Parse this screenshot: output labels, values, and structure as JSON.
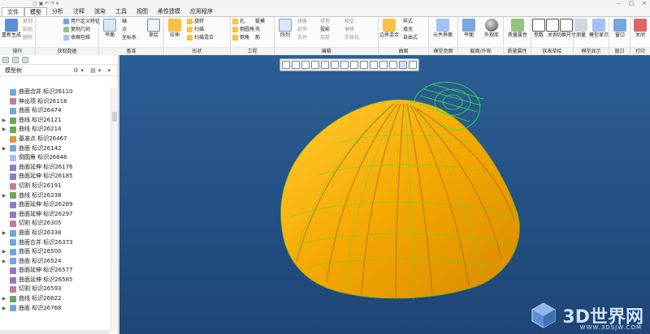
{
  "tabs": [
    "文件",
    "模型",
    "分析",
    "注释",
    "渲染",
    "工具",
    "视图",
    "柔性建模",
    "应用程序"
  ],
  "active_tab": "模型",
  "ribbon": {
    "groups": [
      {
        "label": "操作",
        "big": [
          "重新生成"
        ],
        "small": [
          "复制",
          "粘贴",
          "删除"
        ]
      },
      {
        "label": "获取数据",
        "small": [
          "用户定义特征",
          "复制几何",
          "收缩包络"
        ]
      },
      {
        "label": "基准",
        "big": [
          "平面"
        ],
        "small": [
          "轴",
          "点",
          "坐标系"
        ],
        "extra": [
          "草绘"
        ]
      },
      {
        "label": "形状",
        "big": [
          "拉伸"
        ],
        "small": [
          "旋转",
          "扫描",
          "扫描混合"
        ]
      },
      {
        "label": "工程",
        "small": [
          "孔",
          "倒圆角",
          "倒角",
          "拔模",
          "壳",
          "筋"
        ]
      },
      {
        "label": "编辑",
        "big": [
          "阵列"
        ],
        "small": [
          "镜像",
          "延伸",
          "合并",
          "修剪",
          "投影",
          "加厚",
          "相交",
          "偏移",
          "实体化"
        ]
      },
      {
        "label": "曲面",
        "big": [
          "边界混合"
        ],
        "small": [
          "样式",
          "填充",
          "自由式"
        ]
      },
      {
        "label": "模型意图",
        "big": [
          "元件界面"
        ]
      },
      {
        "label": "截面/外观",
        "big": [
          "平面",
          "外观库"
        ]
      },
      {
        "label": "质量属性",
        "big": [
          "质量属性"
        ]
      },
      {
        "label": "族表草绘",
        "big": [
          "参数",
          "关系",
          "切换尺寸"
        ]
      },
      {
        "label": "模型显示",
        "big": [
          "测量",
          "模型显示"
        ]
      },
      {
        "label": "窗口",
        "big": [
          "窗口"
        ]
      },
      {
        "label": "打印",
        "big": [
          "关闭"
        ]
      }
    ]
  },
  "model_tree": {
    "title": "模型树",
    "items": [
      {
        "label": "曲面合并 标识26110",
        "expand": "",
        "color": "#6fa8dc"
      },
      {
        "label": "伸出项 标识26118",
        "expand": "",
        "color": "#c27ba0"
      },
      {
        "label": "曲面 标识26474",
        "expand": "",
        "color": "#6fa8dc"
      },
      {
        "label": "曲线 标识26121",
        "expand": "▶",
        "color": "#6aa84f"
      },
      {
        "label": "曲线 标识26214",
        "expand": "▶",
        "color": "#6aa84f"
      },
      {
        "label": "基准点 标识26467",
        "expand": "",
        "color": "#e69138"
      },
      {
        "label": "曲面 标识26142",
        "expand": "▶",
        "color": "#6fa8dc"
      },
      {
        "label": "倒圆角 标识26646",
        "expand": "",
        "color": "#a4c2f4"
      },
      {
        "label": "曲面延伸 标识26176",
        "expand": "",
        "color": "#8e7cc3"
      },
      {
        "label": "曲面延伸 标识26185",
        "expand": "",
        "color": "#8e7cc3"
      },
      {
        "label": "切割 标识26191",
        "expand": "",
        "color": "#c27ba0"
      },
      {
        "label": "曲线 标识26238",
        "expand": "▶",
        "color": "#6aa84f"
      },
      {
        "label": "曲面延伸 标识26289",
        "expand": "",
        "color": "#8e7cc3"
      },
      {
        "label": "曲面延伸 标识26297",
        "expand": "",
        "color": "#8e7cc3"
      },
      {
        "label": "切割 标识26305",
        "expand": "",
        "color": "#c27ba0"
      },
      {
        "label": "曲面 标识26338",
        "expand": "▶",
        "color": "#6fa8dc"
      },
      {
        "label": "曲面合并 标识26373",
        "expand": "",
        "color": "#6fa8dc"
      },
      {
        "label": "曲面 标识26500",
        "expand": "▶",
        "color": "#6fa8dc"
      },
      {
        "label": "曲面 标识26524",
        "expand": "▶",
        "color": "#6fa8dc"
      },
      {
        "label": "曲面延伸 标识26577",
        "expand": "",
        "color": "#8e7cc3"
      },
      {
        "label": "曲面延伸 标识26585",
        "expand": "",
        "color": "#8e7cc3"
      },
      {
        "label": "切割 标识26593",
        "expand": "",
        "color": "#c27ba0"
      },
      {
        "label": "曲线 标识26622",
        "expand": "▶",
        "color": "#6aa84f"
      },
      {
        "label": "曲面 标识26768",
        "expand": "▶",
        "color": "#6fa8dc"
      }
    ]
  },
  "watermark": {
    "brand": "3D世界网",
    "url": "WWW.3DSJW.COM"
  },
  "colors": {
    "viewport_top": "#2b5e96",
    "shell": "#f4a800",
    "mesh": "#39e639"
  }
}
